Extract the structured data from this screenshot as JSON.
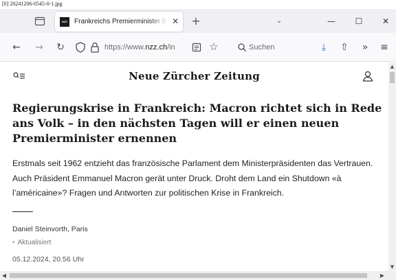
{
  "caption": "[0] 20241206-0545-0-1.jpg",
  "tabbar": {
    "tab_title": "Frankreichs Premierminister Ba",
    "tab_favicon_text": "NZZ",
    "close_glyph": "✕",
    "new_tab_glyph": "+",
    "tab_menu_glyph": "⌄",
    "minimize_glyph": "—",
    "maximize_glyph": "☐",
    "window_close_glyph": "✕"
  },
  "navbar": {
    "back_glyph": "←",
    "forward_glyph": "→",
    "reload_glyph": "↻",
    "url_prefix": "https://www.",
    "url_domain": "nzz.ch",
    "url_suffix": "/in",
    "bookmark_glyph": "☆",
    "search_placeholder": "Suchen",
    "download_glyph": "⤓",
    "share_glyph": "⇧",
    "overflow_glyph": "»",
    "menu_glyph": "≡"
  },
  "site": {
    "masthead": "Neue Zürcher Zeitung"
  },
  "article": {
    "headline": "Regierungskrise in Frankreich: Macron richtet sich in Rede ans Volk – in den nächsten Tagen will er einen neuen Premierminister ernennen",
    "lead": "Erstmals seit 1962 entzieht das französische Parlament dem Ministerpräsidenten das Vertrauen. Auch Präsident Emmanuel Macron gerät unter Druck. Droht dem Land ein Shutdown «à l’américaine»? Fragen und Antworten zur politischen Krise in Frankreich.",
    "author": "Daniel Steinvorth, Paris",
    "update_label": "Aktualisiert",
    "date": "05.12.2024, 20.56 Uhr"
  },
  "scrollbars": {
    "up": "▲",
    "down": "▼",
    "left": "◀",
    "right": "▶"
  }
}
